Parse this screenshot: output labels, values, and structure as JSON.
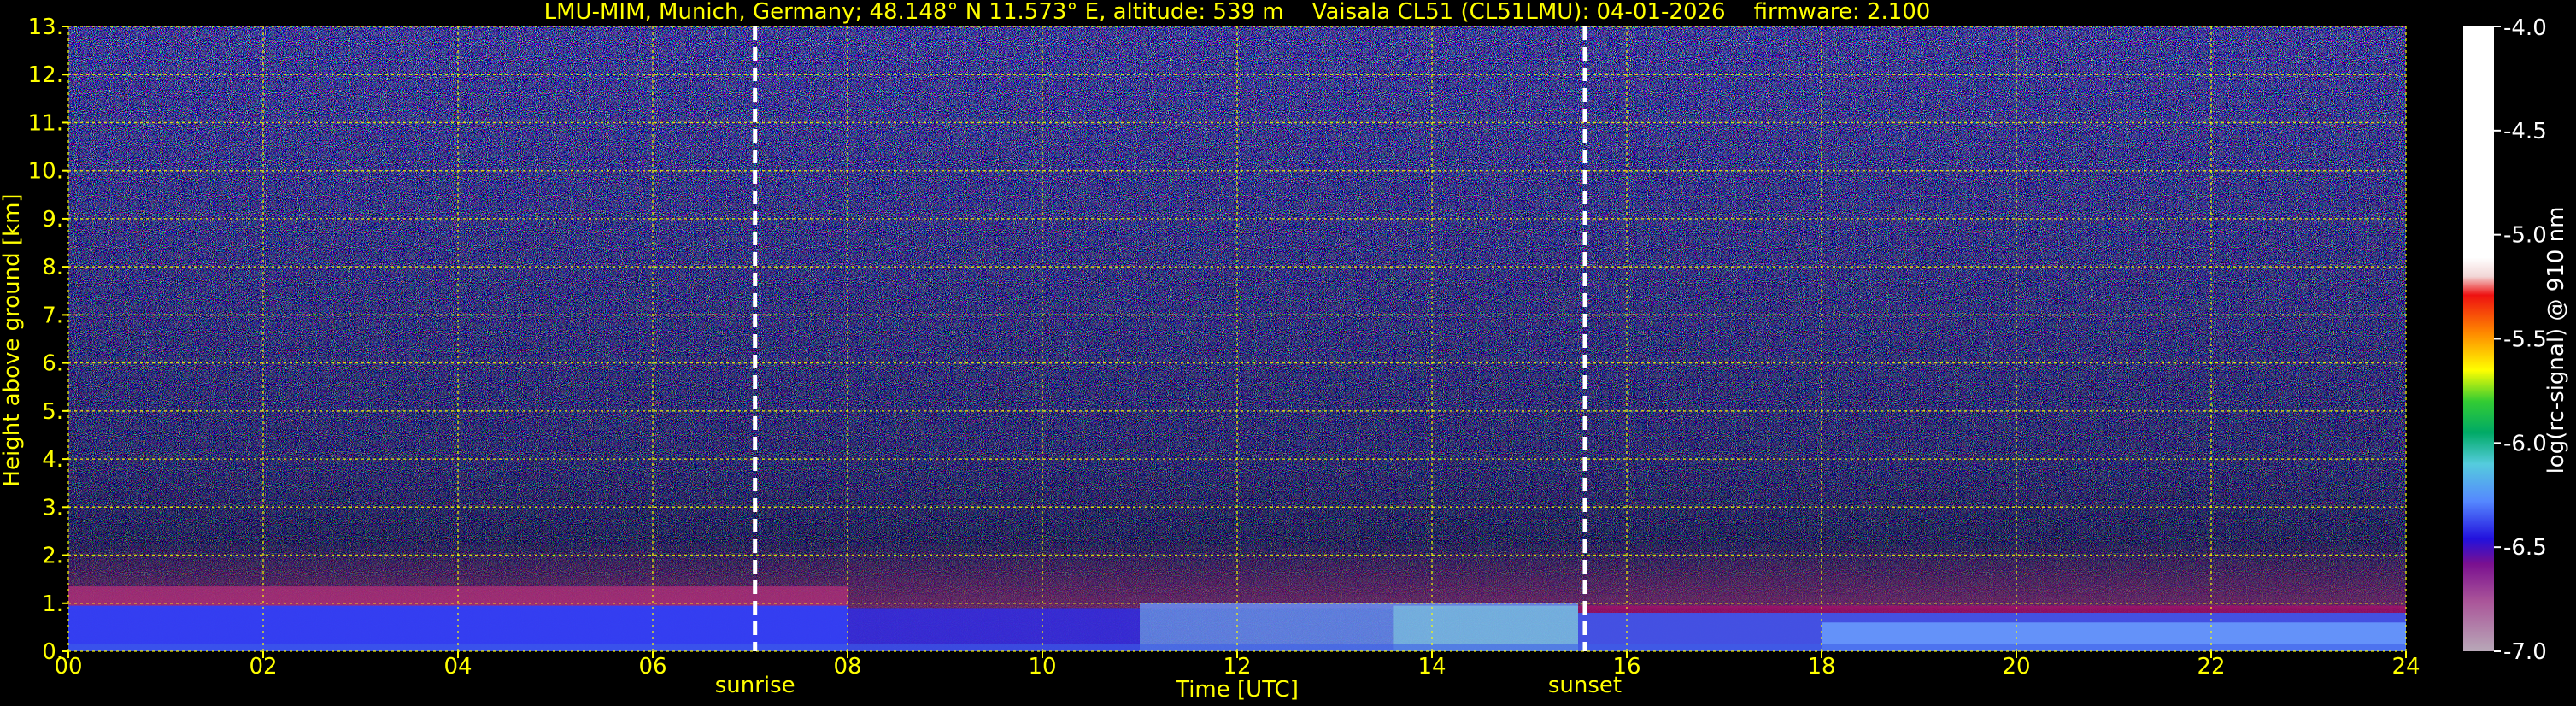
{
  "chart_data": {
    "type": "heatmap",
    "title": "LMU-MIM, Munich, Germany; 48.148° N 11.573° E, altitude: 539 m    Vaisala CL51 (CL51LMU): 04-01-2026    firmware: 2.100",
    "xlabel": "Time [UTC]",
    "ylabel": "Height above ground [km]",
    "xlim": [
      0,
      24
    ],
    "ylim": [
      0,
      13
    ],
    "x_ticks": [
      "00",
      "02",
      "04",
      "06",
      "08",
      "10",
      "12",
      "14",
      "16",
      "18",
      "20",
      "22",
      "24"
    ],
    "y_ticks": [
      "0.",
      "1.",
      "2.",
      "3.",
      "4.",
      "5.",
      "6.",
      "7.",
      "8.",
      "9.",
      "10.",
      "11.",
      "12.",
      "13."
    ],
    "grid": true,
    "annotations": [
      {
        "label": "sunrise",
        "x": 7.05
      },
      {
        "label": "sunset",
        "x": 15.57
      }
    ],
    "colorbar": {
      "label": "log(rc-signal) @ 910 nm",
      "range": [
        -7.0,
        -4.0
      ],
      "ticks": [
        "-4.0",
        "-4.5",
        "-5.0",
        "-5.5",
        "-6.0",
        "-6.5",
        "-7.0"
      ]
    },
    "colors": {
      "text": "#ffff00",
      "grid": "#ffff00",
      "background": "#000000",
      "markers": "#ffffff"
    }
  }
}
